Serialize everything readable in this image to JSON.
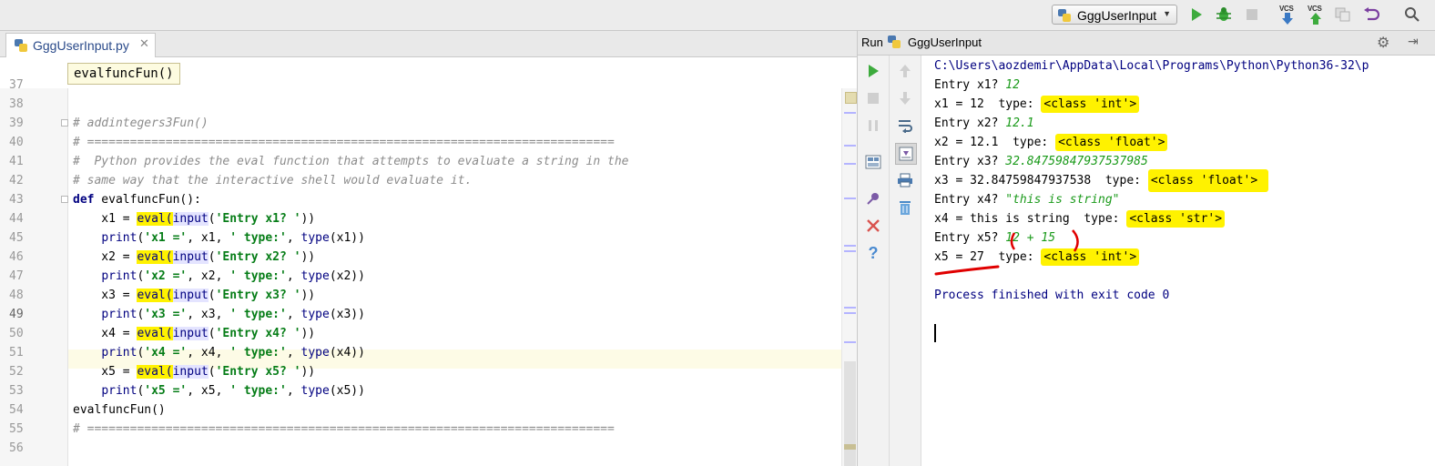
{
  "toolbar": {
    "run_config": "GggUserInput",
    "vcs_label": "VCS",
    "accent_green": "#3dab3d"
  },
  "editor": {
    "tab_name": "GggUserInput.py",
    "breadcrumb": "evalfuncFun()",
    "line_numbers": [
      "37",
      "38",
      "39",
      "40",
      "41",
      "42",
      "43",
      "44",
      "45",
      "46",
      "47",
      "48",
      "49",
      "50",
      "51",
      "52",
      "53",
      "54",
      "55",
      "56"
    ],
    "code": {
      "l38": "# addintegers3Fun()",
      "l39": "# ==========================================================================",
      "l40": "#  Python provides the eval function that attempts to evaluate a string in the",
      "l41": "# same way that the interactive shell would evaluate it.",
      "l42_kw": "def",
      "l42_rest": " evalfuncFun():",
      "l53": "evalfuncFun()",
      "l54": "# ==========================================================================",
      "eval": "eval(",
      "input": "input",
      "print": "print",
      "type": "type",
      "assign_x1": "    x1 = ",
      "assign_x2": "    x2 = ",
      "assign_x3": "    x3 = ",
      "assign_x4": "    x4 = ",
      "assign_x5": "    x5 = ",
      "prompt_x1": "'Entry x1? '",
      "prompt_x2": "'Entry x2? '",
      "prompt_x3": "'Entry x3? '",
      "prompt_x4": "'Entry x4? '",
      "prompt_x5": "'Entry x5? '",
      "label_x1": "'x1 ='",
      "label_x2": "'x2 ='",
      "label_x3": "'x3 ='",
      "label_x4": "'x4 ='",
      "label_x5": "'x5 ='",
      "type_label": "' type:'",
      "arg_x1": "x1",
      "arg_x2": "x2",
      "arg_x3": "x3",
      "arg_x4": "x4",
      "arg_x5": "x5"
    }
  },
  "run": {
    "title": "Run",
    "config": "GggUserInput",
    "output": {
      "path": "C:\\Users\\aozdemir\\AppData\\Local\\Programs\\Python\\Python36-32\\p",
      "prompt_x1": "Entry x1? ",
      "input_x1": "12",
      "res_x1": "x1 = 12  type: ",
      "type_x1": "<class 'int'>",
      "prompt_x2": "Entry x2? ",
      "input_x2": "12.1",
      "res_x2": "x2 = 12.1  type: ",
      "type_x2": "<class 'float'>",
      "prompt_x3": "Entry x3? ",
      "input_x3": "32.84759847937537985",
      "res_x3": "x3 = 32.84759847937538  type: ",
      "type_x3": "<class 'float'>",
      "prompt_x4": "Entry x4? ",
      "input_x4": "\"this is string\"",
      "res_x4": "x4 = this is string  type: ",
      "type_x4": "<class 'str'>",
      "prompt_x5": "Entry x5? ",
      "input_x5": "12 + 15",
      "res_x5": "x5 = 27  type: ",
      "type_x5": "<class 'int'>",
      "exit": "Process finished with exit code 0"
    }
  }
}
